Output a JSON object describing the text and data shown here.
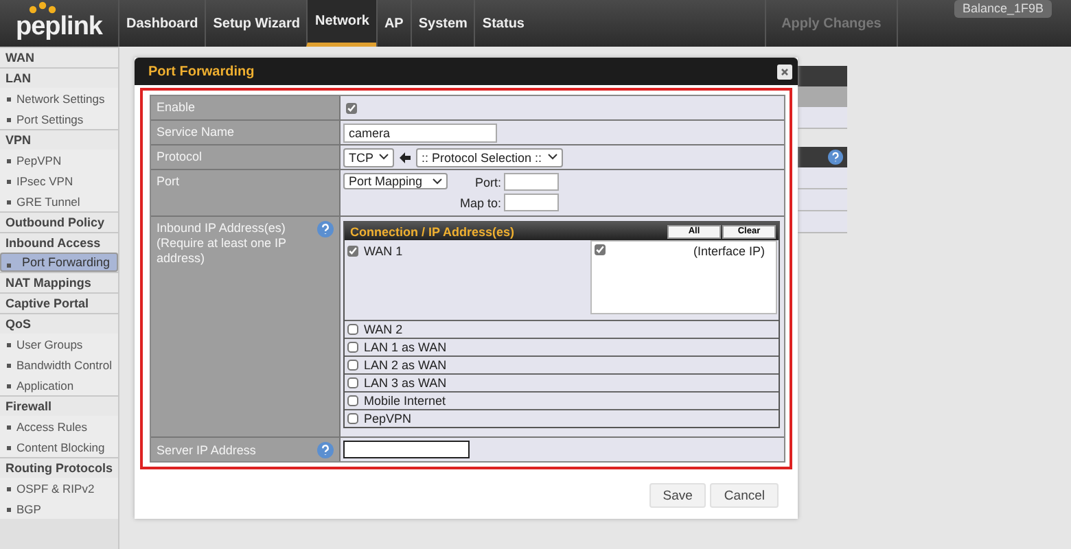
{
  "header": {
    "logo": "peplink",
    "tabs": [
      {
        "label": "Dashboard",
        "selected": false
      },
      {
        "label": "Setup Wizard",
        "selected": false
      },
      {
        "label": "Network",
        "selected": true
      },
      {
        "label": "AP",
        "selected": false
      },
      {
        "label": "System",
        "selected": false
      },
      {
        "label": "Status",
        "selected": false
      }
    ],
    "apply_button": {
      "label": "Apply Changes",
      "disabled": true
    },
    "device_name": "Balance_1F9B"
  },
  "sidebar": {
    "items": [
      {
        "label": "WAN",
        "kind": "section",
        "selected": false
      },
      {
        "label": "LAN",
        "kind": "section",
        "selected": false
      },
      {
        "label": "Network Settings",
        "kind": "item",
        "selected": false
      },
      {
        "label": "Port Settings",
        "kind": "item",
        "selected": false
      },
      {
        "label": "VPN",
        "kind": "section",
        "selected": false
      },
      {
        "label": "PepVPN",
        "kind": "item",
        "selected": false
      },
      {
        "label": "IPsec VPN",
        "kind": "item",
        "selected": false
      },
      {
        "label": "GRE Tunnel",
        "kind": "item",
        "selected": false
      },
      {
        "label": "Outbound Policy",
        "kind": "section",
        "selected": false
      },
      {
        "label": "Inbound Access",
        "kind": "section",
        "selected": false
      },
      {
        "label": "Port Forwarding",
        "kind": "item",
        "selected": true
      },
      {
        "label": "NAT Mappings",
        "kind": "section",
        "selected": false
      },
      {
        "label": "Captive Portal",
        "kind": "section",
        "selected": false
      },
      {
        "label": "QoS",
        "kind": "section",
        "selected": false
      },
      {
        "label": "User Groups",
        "kind": "item",
        "selected": false
      },
      {
        "label": "Bandwidth Control",
        "kind": "item",
        "selected": false
      },
      {
        "label": "Application",
        "kind": "item",
        "selected": false
      },
      {
        "label": "Firewall",
        "kind": "section",
        "selected": false
      },
      {
        "label": "Access Rules",
        "kind": "item",
        "selected": false
      },
      {
        "label": "Content Blocking",
        "kind": "item",
        "selected": false
      },
      {
        "label": "Routing Protocols",
        "kind": "section",
        "selected": false
      },
      {
        "label": "OSPF & RIPv2",
        "kind": "item",
        "selected": false
      },
      {
        "label": "BGP",
        "kind": "item",
        "selected": false
      }
    ]
  },
  "dialog": {
    "title": "Port Forwarding",
    "enable": {
      "label": "Enable",
      "checked": true
    },
    "service_name": {
      "label": "Service Name",
      "value": "camera"
    },
    "protocol": {
      "label": "Protocol",
      "value": "TCP",
      "preset": ":: Protocol Selection ::"
    },
    "port": {
      "label": "Port",
      "mode": "Port Mapping",
      "port_label": "Port:",
      "map_label": "Map to:"
    },
    "inbound": {
      "label": "Inbound IP Address(es)",
      "note": "(Require at least one IP address)",
      "header": "Connection / IP Address(es)",
      "all_button": "All",
      "clear_button": "Clear",
      "connections": [
        {
          "label": "WAN 1",
          "checked": true,
          "interface": {
            "label": "(Interface IP)",
            "checked": true
          }
        },
        {
          "label": "WAN 2",
          "checked": false
        },
        {
          "label": "LAN 1 as WAN",
          "checked": false
        },
        {
          "label": "LAN 2 as WAN",
          "checked": false
        },
        {
          "label": "LAN 3 as WAN",
          "checked": false
        },
        {
          "label": "Mobile Internet",
          "checked": false
        },
        {
          "label": "PepVPN",
          "checked": false
        }
      ]
    },
    "server_ip": {
      "label": "Server IP Address"
    },
    "buttons": [
      "Save",
      "Cancel"
    ]
  }
}
